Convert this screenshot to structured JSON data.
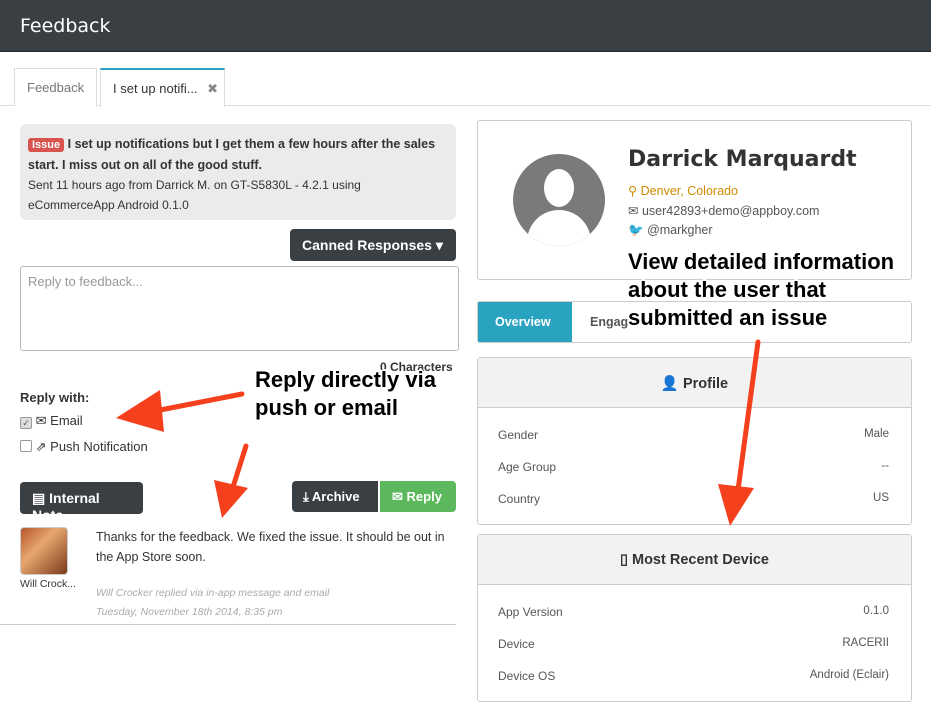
{
  "header": {
    "title": "Feedback"
  },
  "tabs": [
    {
      "label": "Feedback"
    },
    {
      "label": "I set up notifi...",
      "close": "✖"
    }
  ],
  "issue": {
    "badge": "Issue",
    "title": "I set up notifications but I get them a few hours after the sales start. I miss out on all of the good stuff.",
    "meta": "Sent 11 hours ago from Darrick M. on GT-S5830L - 4.2.1 using eCommerceApp Android 0.1.0"
  },
  "canned_label": "Canned Responses ▾",
  "reply_box": {
    "placeholder": "Reply to feedback..."
  },
  "char_count": "0 Characters",
  "reply_with": {
    "label": "Reply with:",
    "email": "Email",
    "push": "Push Notification"
  },
  "buttons": {
    "note": "Internal Note",
    "archive": "Archive",
    "reply": "Reply"
  },
  "message": {
    "author_short": "Will Crock...",
    "text": "Thanks for the feedback. We fixed the issue. It should be out in the App Store soon.",
    "meta1": "Will Crocker replied via in-app message and email",
    "meta2": "Tuesday, November 18th 2014, 8:35 pm"
  },
  "user": {
    "name": "Darrick Marquardt",
    "location": "Denver, Colorado",
    "email": "user42893+demo@appboy.com",
    "twitter": "@markgher"
  },
  "user_tabs": {
    "overview": "Overview",
    "engagement": "Engag"
  },
  "profile": {
    "title": "Profile",
    "rows": [
      {
        "label": "Gender",
        "value": "Male"
      },
      {
        "label": "Age Group",
        "value": "--"
      },
      {
        "label": "Country",
        "value": "US"
      }
    ]
  },
  "device": {
    "title": "Most Recent Device",
    "rows": [
      {
        "label": "App Version",
        "value": "0.1.0"
      },
      {
        "label": "Device",
        "value": "RACERII"
      },
      {
        "label": "Device OS",
        "value": "Android (Eclair)"
      }
    ]
  },
  "annotations": {
    "left": "Reply directly via push or email",
    "right": "View detailed information about the user that submitted an issue"
  },
  "colors": {
    "accent": "#2aa3c1",
    "issue": "#d9534f",
    "reply": "#5cb85c",
    "arrow": "#f5401e",
    "location": "#d08b00"
  }
}
